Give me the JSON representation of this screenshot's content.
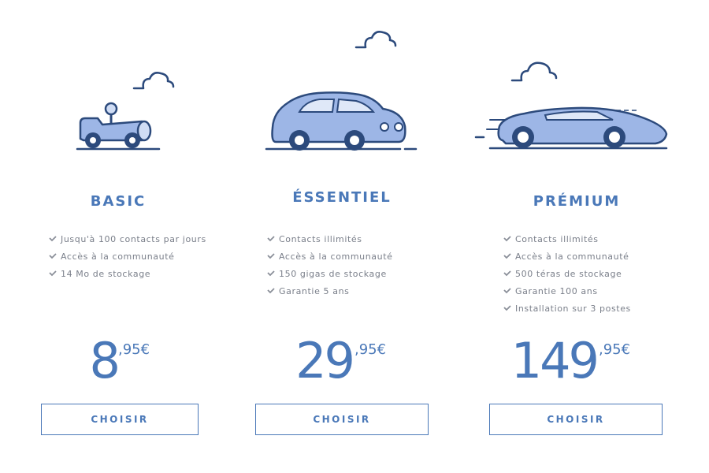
{
  "plans": [
    {
      "name": "BASIC",
      "illustration_icon": "toy-car-icon",
      "features": [
        "Jusqu'à 100 contacts par jours",
        "Accès à la communauté",
        "14 Mo de stockage"
      ],
      "price_integer": "8",
      "price_decimal": ",95€",
      "button_label": "CHOISIR"
    },
    {
      "name": "ÉSSENTIEL",
      "illustration_icon": "car-icon",
      "features": [
        "Contacts illimités",
        "Accès à la communauté",
        "150 gigas de stockage",
        "Garantie 5 ans"
      ],
      "price_integer": "29",
      "price_decimal": ",95€",
      "button_label": "CHOISIR"
    },
    {
      "name": "PRÉMIUM",
      "illustration_icon": "sports-car-icon",
      "features": [
        "Contacts illimités",
        "Accès à la communauté",
        "500 téras de stockage",
        "Garantie 100 ans",
        "Installation sur 3 postes"
      ],
      "price_integer": "149",
      "price_decimal": ",95€",
      "button_label": "CHOISIR"
    }
  ],
  "colors": {
    "accent": "#4a78b8",
    "dark_outline": "#2c4a7c",
    "car_fill": "#9db6e6",
    "text_muted": "#7a7f8a"
  }
}
